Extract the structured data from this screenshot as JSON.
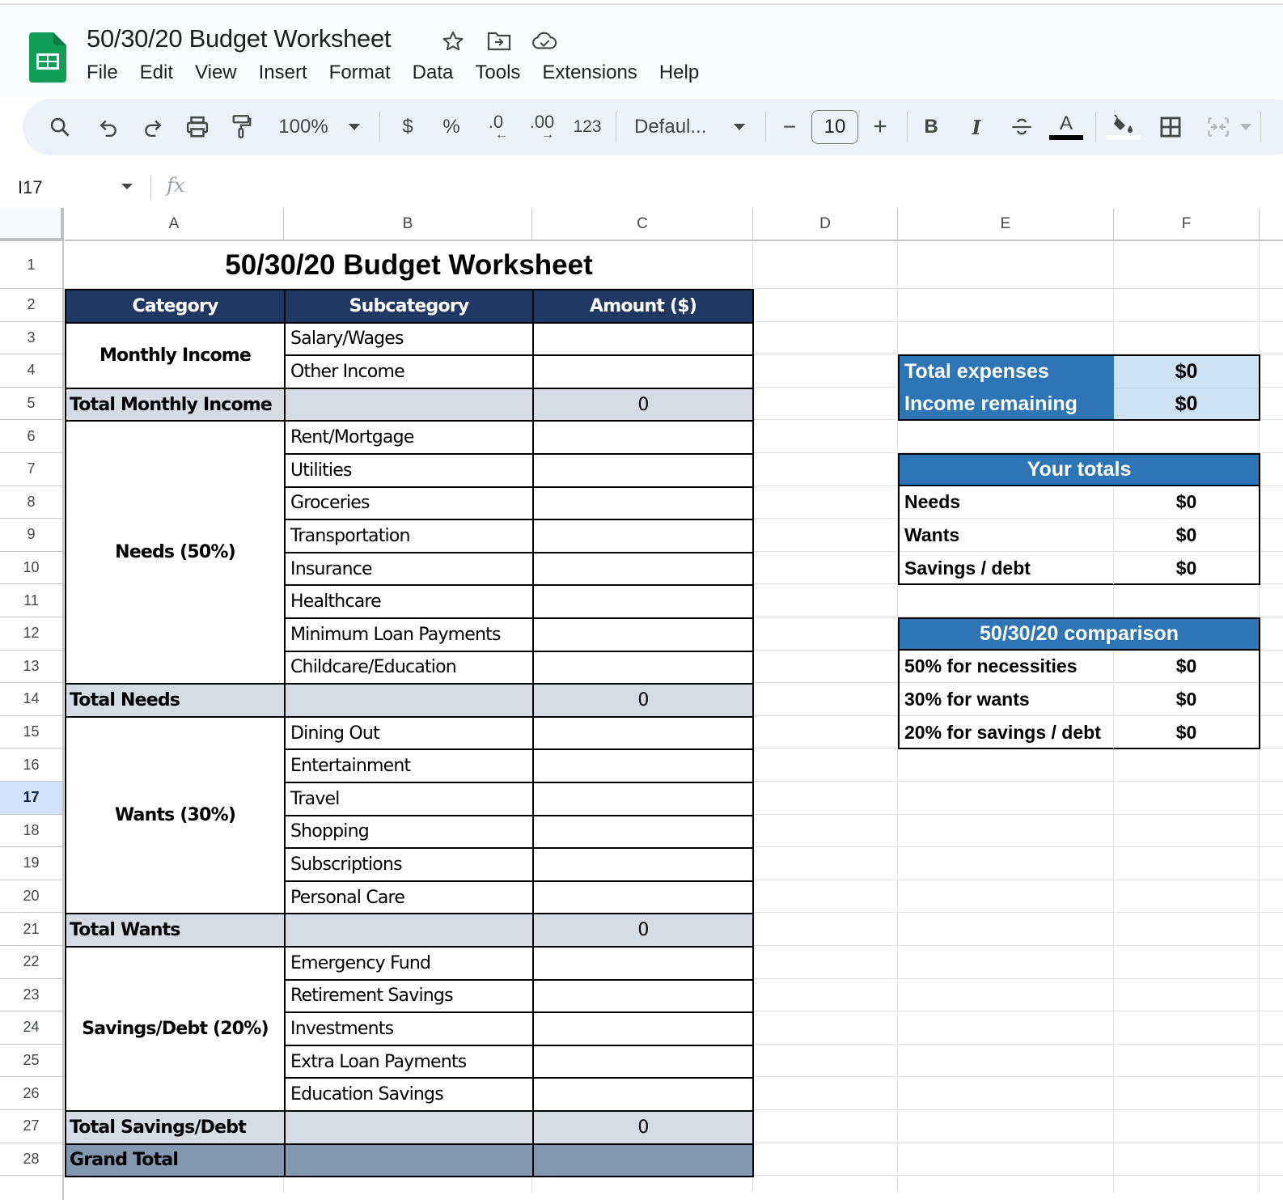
{
  "app": {
    "doc_title": "50/30/20 Budget Worksheet",
    "icons": [
      "star-icon",
      "move-to-folder-icon",
      "cloud-saved-icon"
    ],
    "menu": [
      "File",
      "Edit",
      "View",
      "Insert",
      "Format",
      "Data",
      "Tools",
      "Extensions",
      "Help"
    ]
  },
  "toolbar": {
    "zoom": "100%",
    "currency": "$",
    "percent": "%",
    "decrease_decimal": ".0",
    "increase_decimal": ".00",
    "number_format": "123",
    "font": "Defaul...",
    "font_size": "10",
    "minus": "−",
    "plus": "+",
    "bold": "B",
    "italic": "I",
    "text_color": "A",
    "text_color_hex": "#000000",
    "fill_color_hex": "#ffffff"
  },
  "formula_bar": {
    "name_box": "I17",
    "fx": "fx",
    "formula": ""
  },
  "columns": [
    "A",
    "B",
    "C",
    "D",
    "E",
    "F"
  ],
  "rows": [
    "1",
    "2",
    "3",
    "4",
    "5",
    "6",
    "7",
    "8",
    "9",
    "10",
    "11",
    "12",
    "13",
    "14",
    "15",
    "16",
    "17",
    "18",
    "19",
    "20",
    "21",
    "22",
    "23",
    "24",
    "25",
    "26",
    "27",
    "28"
  ],
  "selected_row": "17",
  "sheet": {
    "title": "50/30/20 Budget Worksheet",
    "headers": {
      "category": "Category",
      "subcategory": "Subcategory",
      "amount": "Amount ($)"
    },
    "sections": [
      {
        "category": "Monthly Income",
        "items": [
          "Salary/Wages",
          "Other Income"
        ],
        "total_label": "Total Monthly Income",
        "total_value": "0"
      },
      {
        "category": "Needs (50%)",
        "items": [
          "Rent/Mortgage",
          "Utilities",
          "Groceries",
          "Transportation",
          "Insurance",
          "Healthcare",
          "Minimum Loan Payments",
          "Childcare/Education"
        ],
        "total_label": "Total Needs",
        "total_value": "0"
      },
      {
        "category": "Wants (30%)",
        "items": [
          "Dining Out",
          "Entertainment",
          "Travel",
          "Shopping",
          "Subscriptions",
          "Personal Care"
        ],
        "total_label": "Total Wants",
        "total_value": "0"
      },
      {
        "category": "Savings/Debt (20%)",
        "items": [
          "Emergency Fund",
          "Retirement Savings",
          "Investments",
          "Extra Loan Payments",
          "Education Savings"
        ],
        "total_label": "Total Savings/Debt",
        "total_value": "0"
      }
    ],
    "grand_total_label": "Grand Total",
    "grand_total_value": ""
  },
  "summary": {
    "total_expenses_label": "Total expenses",
    "total_expenses_value": "$0",
    "income_remaining_label": "Income remaining",
    "income_remaining_value": "$0"
  },
  "your_totals": {
    "title": "Your totals",
    "rows": [
      {
        "label": "Needs",
        "value": "$0"
      },
      {
        "label": "Wants",
        "value": "$0"
      },
      {
        "label": "Savings / debt",
        "value": "$0"
      }
    ]
  },
  "comparison": {
    "title": "50/30/20 comparison",
    "rows": [
      {
        "label": "50% for necessities",
        "value": "$0"
      },
      {
        "label": "30% for wants",
        "value": "$0"
      },
      {
        "label": "20% for savings / debt",
        "value": "$0"
      }
    ]
  },
  "colors": {
    "header_dark": "#1f3864",
    "total_row": "#d6dce4",
    "grand_total_row": "#8497b0",
    "summary_blue": "#2e75b6",
    "summary_light": "#cfe2f3",
    "sheets_green": "#0f9d58"
  }
}
